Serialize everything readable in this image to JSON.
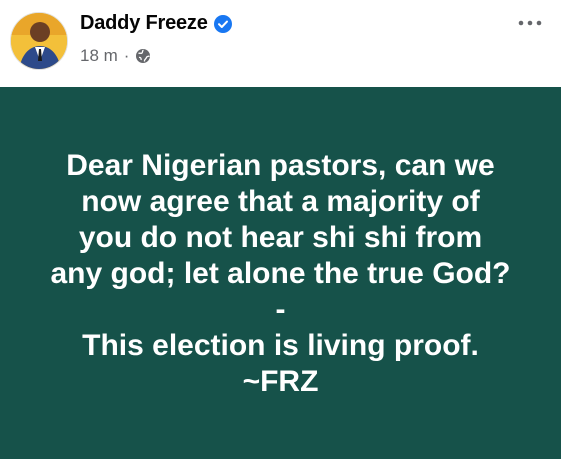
{
  "author": {
    "name": "Daddy Freeze",
    "verified_icon": "verified-badge-icon",
    "avatar_icon": "profile-avatar"
  },
  "meta": {
    "timestamp": "18 m",
    "separator": "·",
    "audience_icon": "globe-icon"
  },
  "menu": {
    "icon": "more-options-icon"
  },
  "post": {
    "background_color": "#16524a",
    "text_color": "#ffffff",
    "lines": [
      "Dear Nigerian pastors, can we",
      "now agree that a majority of",
      "you do not hear shi shi from",
      "any god; let alone the true God?",
      "-",
      "This election is living proof.",
      "~FRZ"
    ]
  }
}
